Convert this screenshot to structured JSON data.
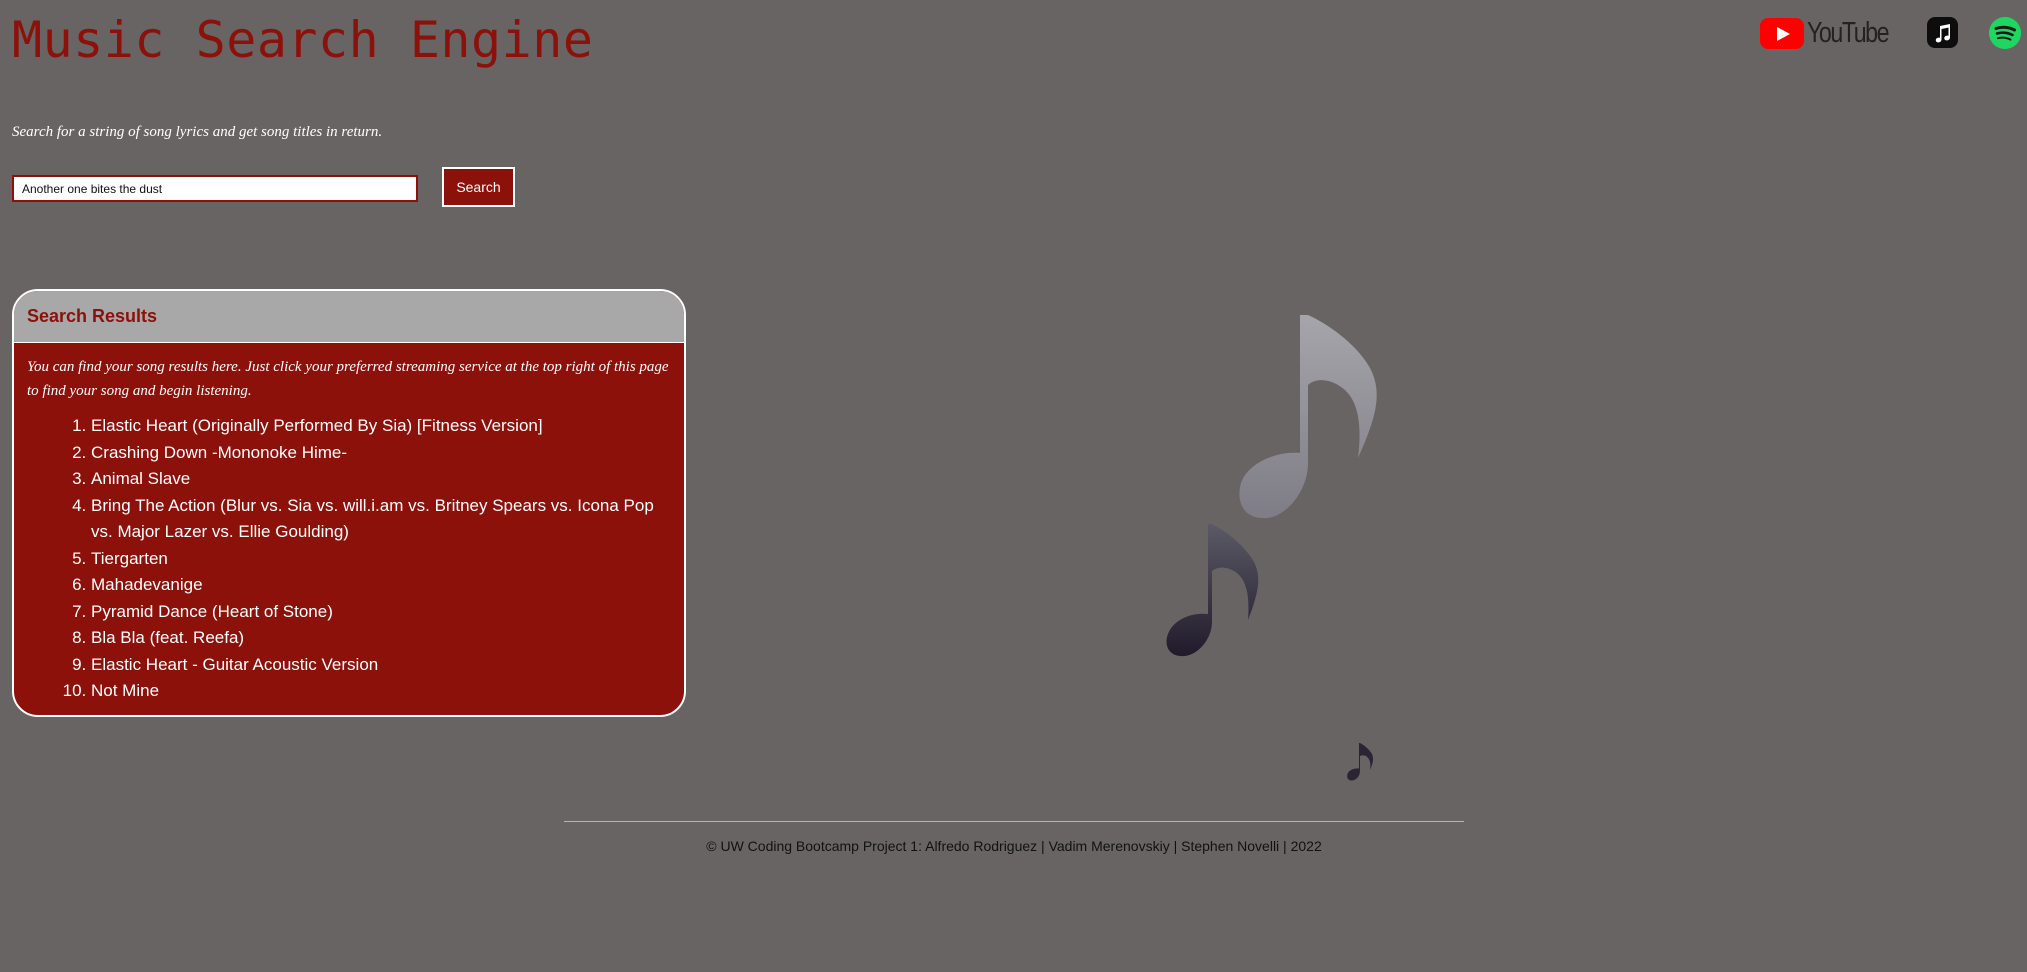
{
  "header": {
    "title": "Music Search Engine",
    "subtitle": "Search for a string of song lyrics and get song titles in return."
  },
  "search": {
    "value": "Another one bites the dust",
    "button_label": "Search"
  },
  "logos": {
    "youtube_text": "YouTube",
    "youtube_icon": "youtube-play-icon",
    "apple_music_icon": "music-note-icon",
    "spotify_icon": "spotify-icon"
  },
  "results": {
    "title": "Search Results",
    "description": "You can find your song results here. Just click your preferred streaming service at the top right of this page to find your song and begin listening.",
    "items": [
      "Elastic Heart (Originally Performed By Sia) [Fitness Version]",
      "Crashing Down -Mononoke Hime-",
      "Animal Slave",
      "Bring The Action (Blur vs. Sia vs. will.i.am vs. Britney Spears vs. Icona Pop vs. Major Lazer vs. Ellie Goulding)",
      "Tiergarten",
      "Mahadevanige",
      "Pyramid Dance (Heart of Stone)",
      "Bla Bla (feat. Reefa)",
      "Elastic Heart - Guitar Acoustic Version",
      "Not Mine"
    ]
  },
  "footer": {
    "text": "© UW Coding Bootcamp Project 1: Alfredo Rodriguez | Vadim Merenovskiy | Stephen Novelli | 2022"
  },
  "colors": {
    "background": "#696464",
    "accent": "#8b110a",
    "header_bar": "#a8a8a8",
    "youtube_red": "#ff0000",
    "spotify_green": "#1ed760"
  }
}
